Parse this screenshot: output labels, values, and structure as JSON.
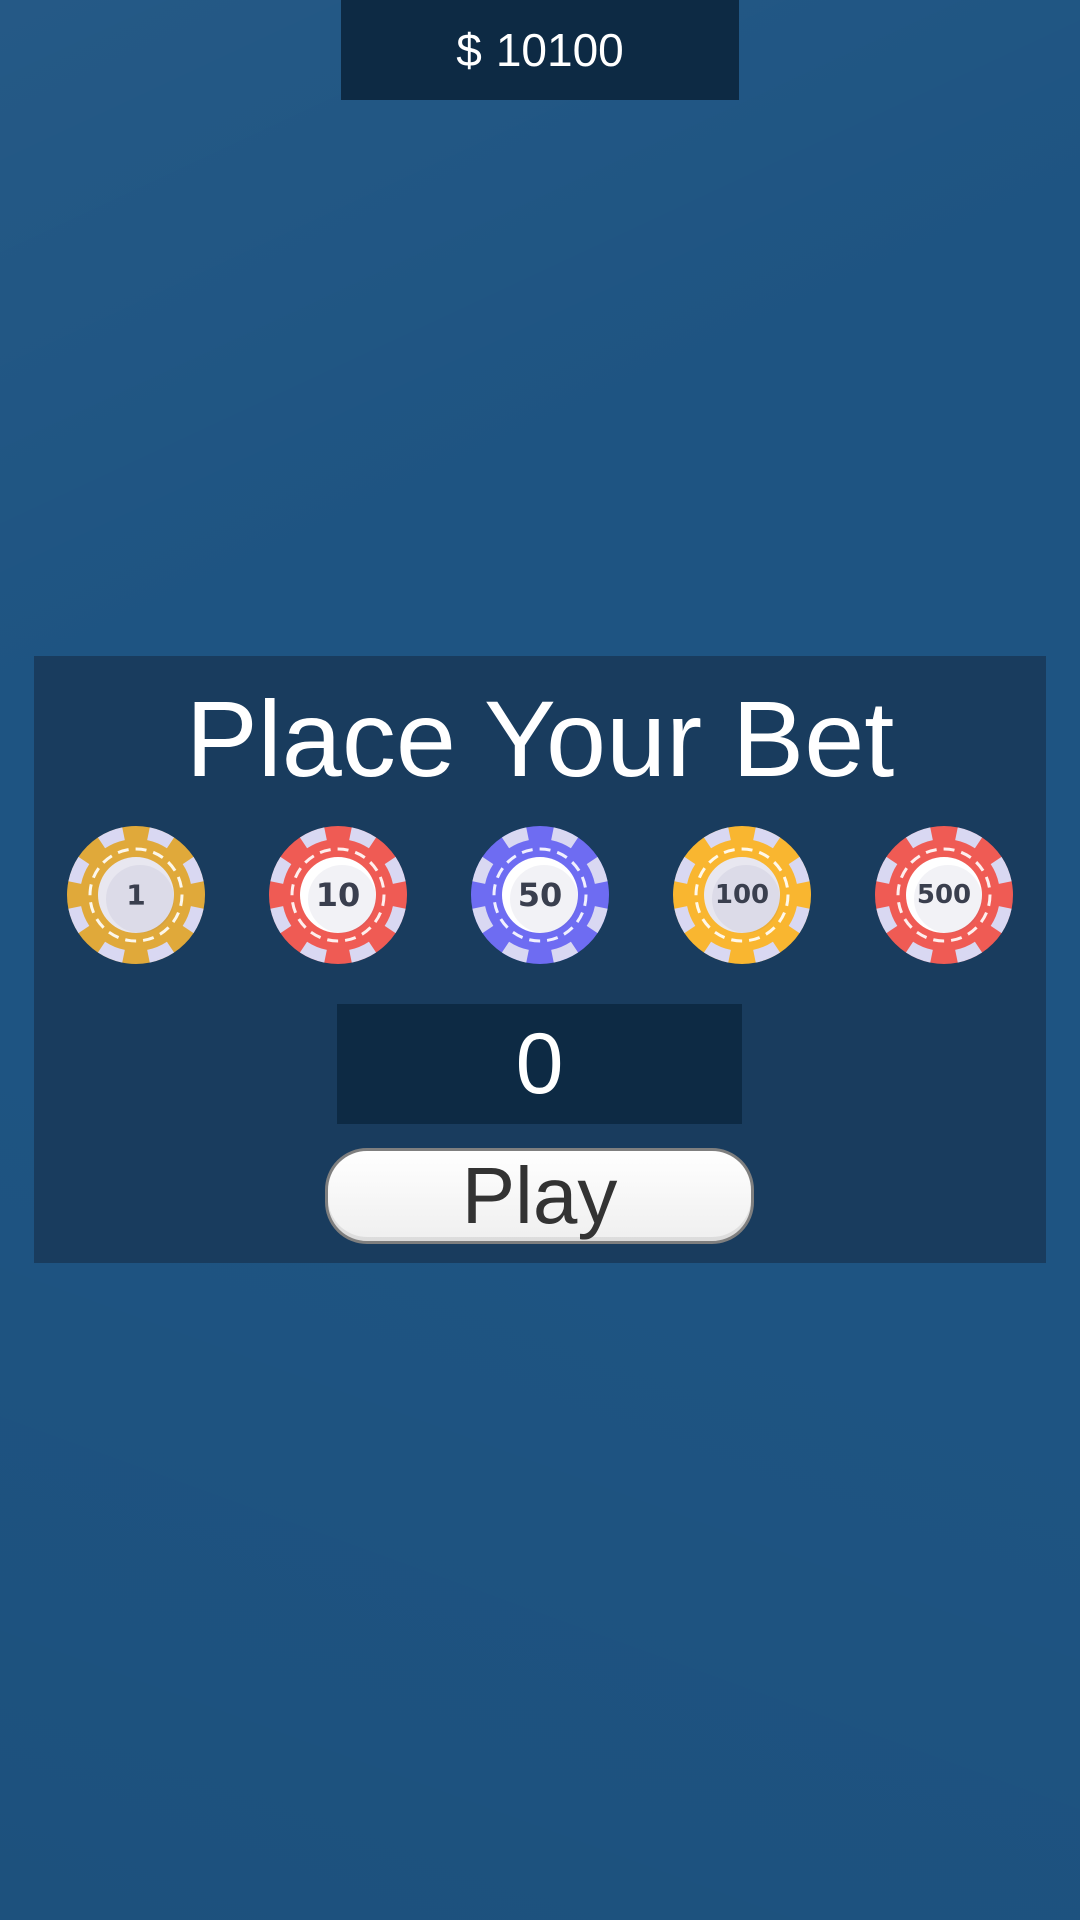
{
  "balance": {
    "currency": "$",
    "amount": "10100"
  },
  "bet_panel": {
    "title": "Place Your Bet",
    "current_bet": "0",
    "play_label": "Play"
  },
  "chips": [
    {
      "label": "1",
      "color": "#e0a93a",
      "center": "#e8e7f0",
      "icon": "chip-1-icon"
    },
    {
      "label": "10",
      "color": "#ef5b54",
      "center": "#ffffff",
      "icon": "chip-10-icon"
    },
    {
      "label": "50",
      "color": "#6e6cf2",
      "center": "#ffffff",
      "icon": "chip-50-icon"
    },
    {
      "label": "100",
      "color": "#f9b630",
      "center": "#e8e7f0",
      "icon": "chip-100-icon"
    },
    {
      "label": "500",
      "color": "#ef5b54",
      "center": "#ffffff",
      "icon": "chip-500-icon"
    }
  ],
  "colors": {
    "background": "#1e5482",
    "panel": "#193c5e",
    "box": "#0d2a44",
    "chip_notch": "#d9d8f2"
  }
}
